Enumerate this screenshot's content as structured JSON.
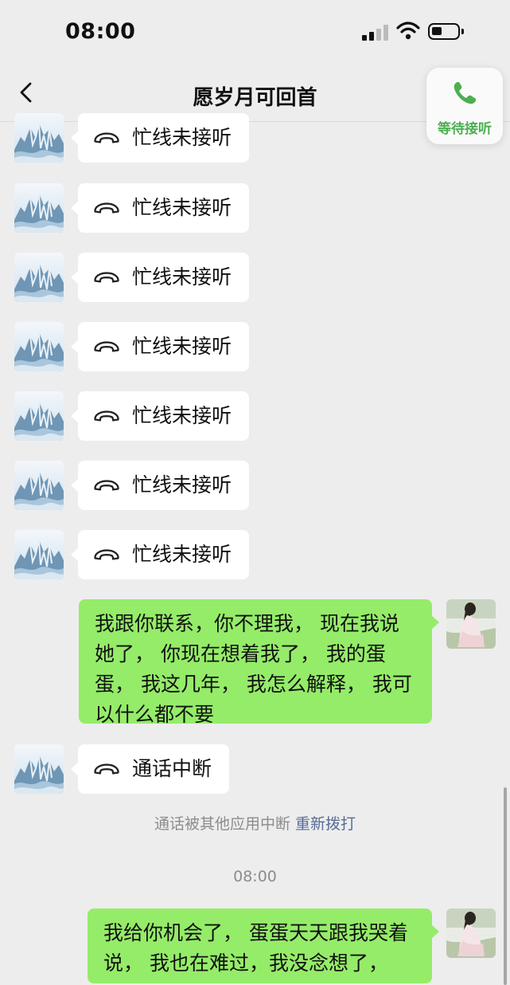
{
  "status_bar": {
    "time": "08:00"
  },
  "nav": {
    "title": "愿岁月可回首"
  },
  "call_widget": {
    "label": "等待接听"
  },
  "messages": [
    {
      "text": "忙线未接听"
    },
    {
      "text": "忙线未接听"
    },
    {
      "text": "忙线未接听"
    },
    {
      "text": "忙线未接听"
    },
    {
      "text": "忙线未接听"
    },
    {
      "text": "忙线未接听"
    },
    {
      "text": "忙线未接听"
    },
    {
      "text": "我跟你联系，你不理我，  现在我说她了，  你现在想着我了，  我的蛋蛋，  我这几年，  我怎么解释，  我可以什么都不要"
    },
    {
      "text": "通话中断"
    },
    {
      "text": "我给你机会了，  蛋蛋天天跟我哭着说，  我也在难过，我没念想了，"
    }
  ],
  "system": {
    "interrupt_note": "通话被其他应用中断",
    "redial_label": "重新拨打",
    "timestamp": "08:00"
  },
  "colors": {
    "sent_bubble": "#95ec69",
    "link": "#576b95",
    "call_green": "#4caf50"
  }
}
